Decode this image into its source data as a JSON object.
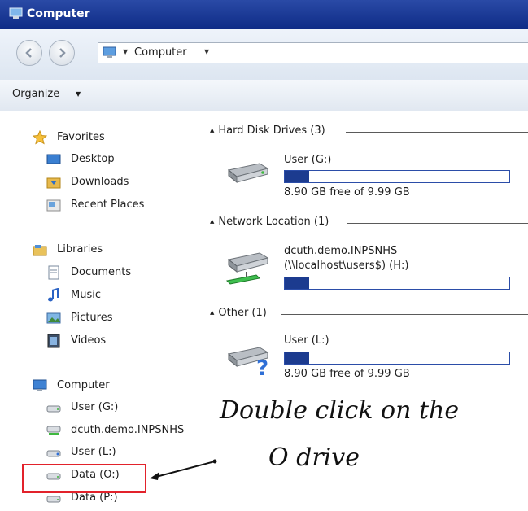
{
  "window": {
    "title": "Computer"
  },
  "navbar": {
    "address_crumb": "Computer"
  },
  "commandbar": {
    "organize_label": "Organize"
  },
  "sidebar": {
    "favorites": {
      "label": "Favorites",
      "items": [
        "Desktop",
        "Downloads",
        "Recent Places"
      ]
    },
    "libraries": {
      "label": "Libraries",
      "items": [
        "Documents",
        "Music",
        "Pictures",
        "Videos"
      ]
    },
    "computer": {
      "label": "Computer",
      "items": [
        "User (G:)",
        "dcuth.demo.INPSNHS",
        "User (L:)",
        "Data (O:)",
        "Data (P:)"
      ]
    }
  },
  "main": {
    "groups": [
      {
        "label": "Hard Disk Drives (3)"
      },
      {
        "label": "Network Location (1)"
      },
      {
        "label": "Other (1)"
      }
    ],
    "drives": [
      {
        "name": "User (G:)",
        "free_text": "8.90 GB free of 9.99 GB",
        "used_fraction": 0.11
      },
      {
        "name_line1": "dcuth.demo.INPSNHS",
        "name_line2": "(\\\\localhost\\users$) (H:)",
        "used_fraction": 0.11
      },
      {
        "name": "User (L:)",
        "free_text": "8.90 GB free of 9.99 GB",
        "used_fraction": 0.11
      }
    ]
  },
  "annotation": {
    "line1": "Double click on the",
    "line2": "O drive",
    "color": "#e2222b"
  }
}
